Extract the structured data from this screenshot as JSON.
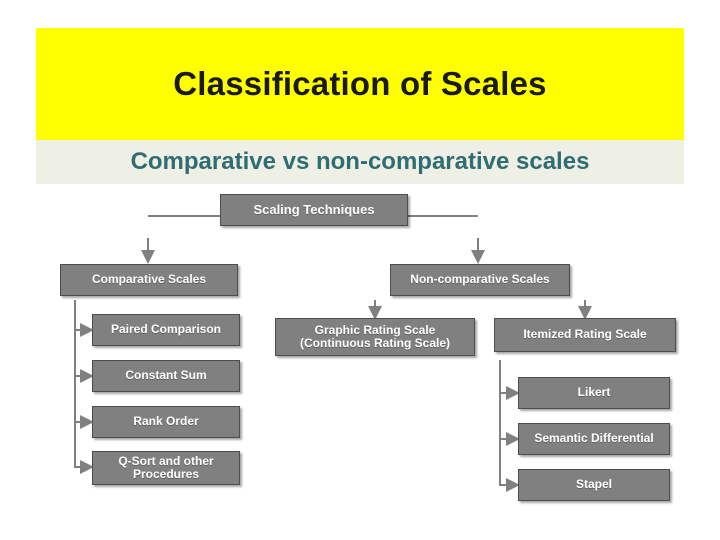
{
  "header": {
    "title": "Classification of Scales",
    "subtitle": "Comparative vs non-comparative scales",
    "title_bg": "#ffff00",
    "subtitle_bg": "#eef0e6",
    "subtitle_color": "#2f6d72"
  },
  "diagram": {
    "type": "hierarchy-flowchart",
    "node_fill": "#808080",
    "node_border": "#4d4d4d",
    "leaf_fill": "#ffffff",
    "leaf_text": "#333333",
    "nodes": [
      {
        "id": "root",
        "label": "Scaling Techniques"
      },
      {
        "id": "comparative",
        "label": "Comparative Scales"
      },
      {
        "id": "noncomparative",
        "label": "Non-comparative Scales"
      },
      {
        "id": "paired",
        "label": "Paired Comparison"
      },
      {
        "id": "constant",
        "label": "Constant Sum"
      },
      {
        "id": "rank",
        "label": "Rank Order"
      },
      {
        "id": "qsort",
        "label": "Q-Sort and other Procedures"
      },
      {
        "id": "graphic",
        "label": "Graphic Rating Scale (Continuous Rating Scale)"
      },
      {
        "id": "itemized",
        "label": "Itemized Rating Scale"
      },
      {
        "id": "likert",
        "label": "Likert"
      },
      {
        "id": "semantic",
        "label": "Semantic Differential"
      },
      {
        "id": "stapel",
        "label": "Stapel"
      }
    ],
    "edges": [
      {
        "from": "root",
        "to": "comparative"
      },
      {
        "from": "root",
        "to": "noncomparative"
      },
      {
        "from": "comparative",
        "to": "paired"
      },
      {
        "from": "comparative",
        "to": "constant"
      },
      {
        "from": "comparative",
        "to": "rank"
      },
      {
        "from": "comparative",
        "to": "qsort"
      },
      {
        "from": "noncomparative",
        "to": "graphic"
      },
      {
        "from": "noncomparative",
        "to": "itemized"
      },
      {
        "from": "itemized",
        "to": "likert"
      },
      {
        "from": "itemized",
        "to": "semantic"
      },
      {
        "from": "itemized",
        "to": "stapel"
      }
    ]
  }
}
